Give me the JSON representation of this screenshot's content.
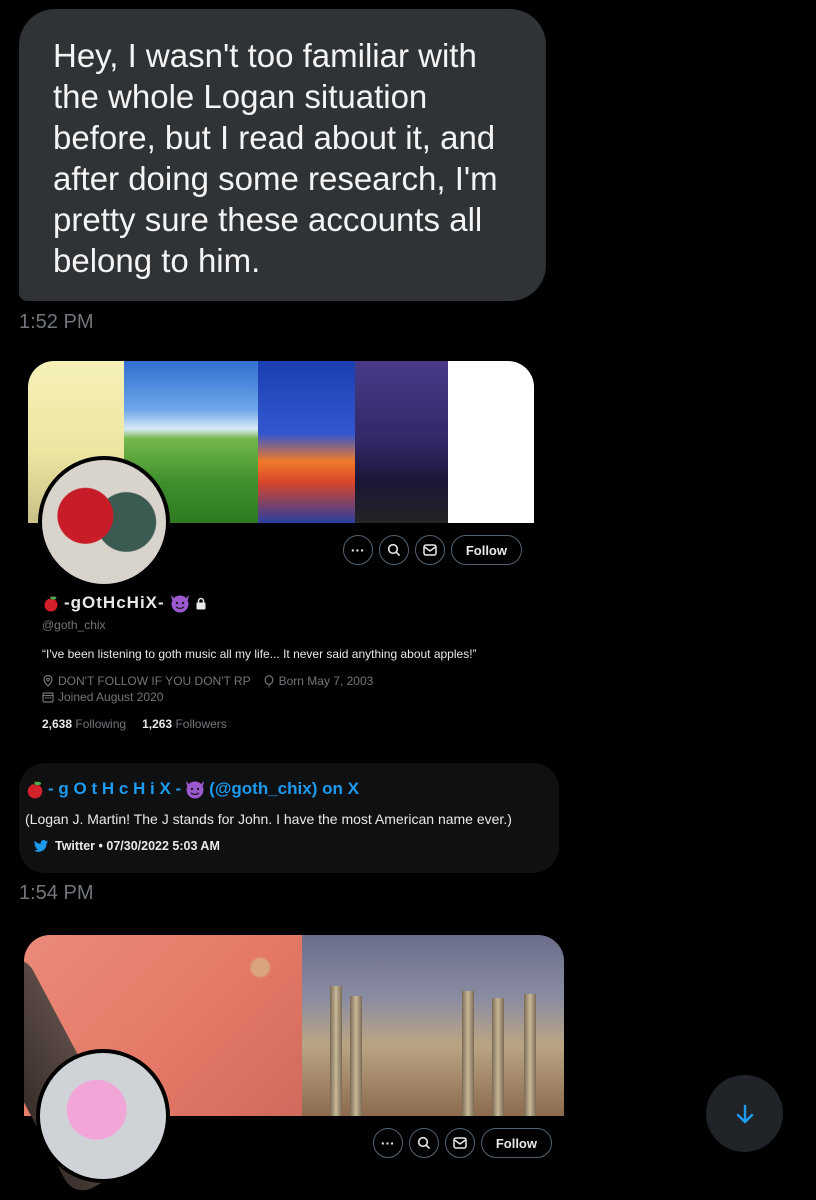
{
  "message": {
    "lines": [
      "Hey, I wasn't too familiar with",
      "the whole Logan situation",
      "before, but I read about it, and",
      "after doing some research, I'm",
      "pretty sure these accounts all",
      "belong to him."
    ],
    "time": "1:52 PM"
  },
  "profile1": {
    "display_name": "-gOtHcHiX-",
    "handle": "@goth_chix",
    "bio": "“I've been listening to goth music all my life... It never said anything about apples!”",
    "location": "DON'T FOLLOW IF YOU DON'T RP",
    "birthday": "Born May 7, 2003",
    "joined": "Joined August 2020",
    "following_count": "2,638",
    "following_label": "Following",
    "followers_count": "1,263",
    "followers_label": "Followers",
    "follow_label": "Follow",
    "more_label": "···"
  },
  "embed": {
    "name": "- g O t H c H i X -",
    "handle_text": "(@goth_chix) on X",
    "text": "(Logan J. Martin! The J stands for John. I have the most American name ever.)",
    "source": "Twitter • 07/30/2022 5:03 AM"
  },
  "time2": "1:54 PM",
  "profile2": {
    "follow_label": "Follow",
    "more_label": "···"
  },
  "colors": {
    "background": "#000000",
    "bubble": "#2f3336",
    "link": "#1d9bf0",
    "muted": "#71767b"
  },
  "icons": [
    "apple-icon",
    "devil-emoji-icon",
    "lock-icon",
    "search-icon",
    "mail-icon",
    "location-icon",
    "balloon-icon",
    "calendar-icon",
    "twitter-bird-icon",
    "arrow-down-icon"
  ]
}
